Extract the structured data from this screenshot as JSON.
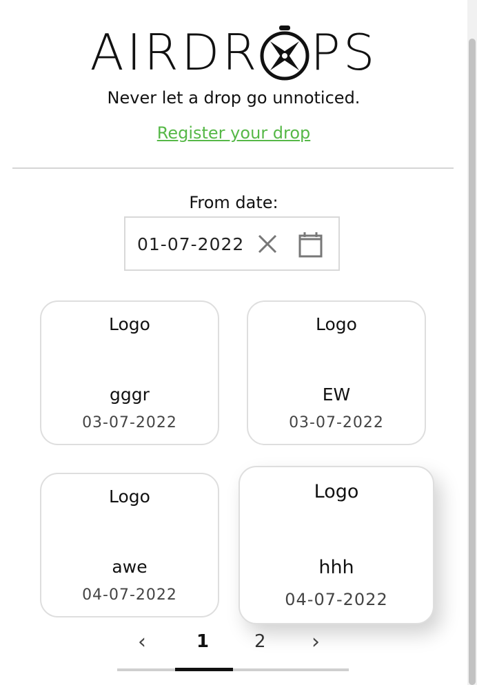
{
  "header": {
    "logo_left": "AIRDR",
    "logo_right": "PS",
    "tagline": "Never let a drop go unnoticed.",
    "register_link": "Register your drop"
  },
  "filter": {
    "label": "From date:",
    "date_value": "01-07-2022"
  },
  "cards": [
    {
      "logo": "Logo",
      "name": "gggr",
      "date": "03-07-2022"
    },
    {
      "logo": "Logo",
      "name": "EW",
      "date": "03-07-2022"
    },
    {
      "logo": "Logo",
      "name": "awe",
      "date": "04-07-2022"
    },
    {
      "logo": "Logo",
      "name": "hhh",
      "date": "04-07-2022"
    }
  ],
  "pagination": {
    "prev": "‹",
    "pages": [
      "1",
      "2"
    ],
    "active_page": "1",
    "next": "›"
  },
  "colors": {
    "accent_link": "#56b847",
    "text": "#111111",
    "border": "#dedede"
  },
  "icons": [
    "compass-icon",
    "clear-icon",
    "calendar-icon",
    "chevron-left-icon",
    "chevron-right-icon"
  ]
}
